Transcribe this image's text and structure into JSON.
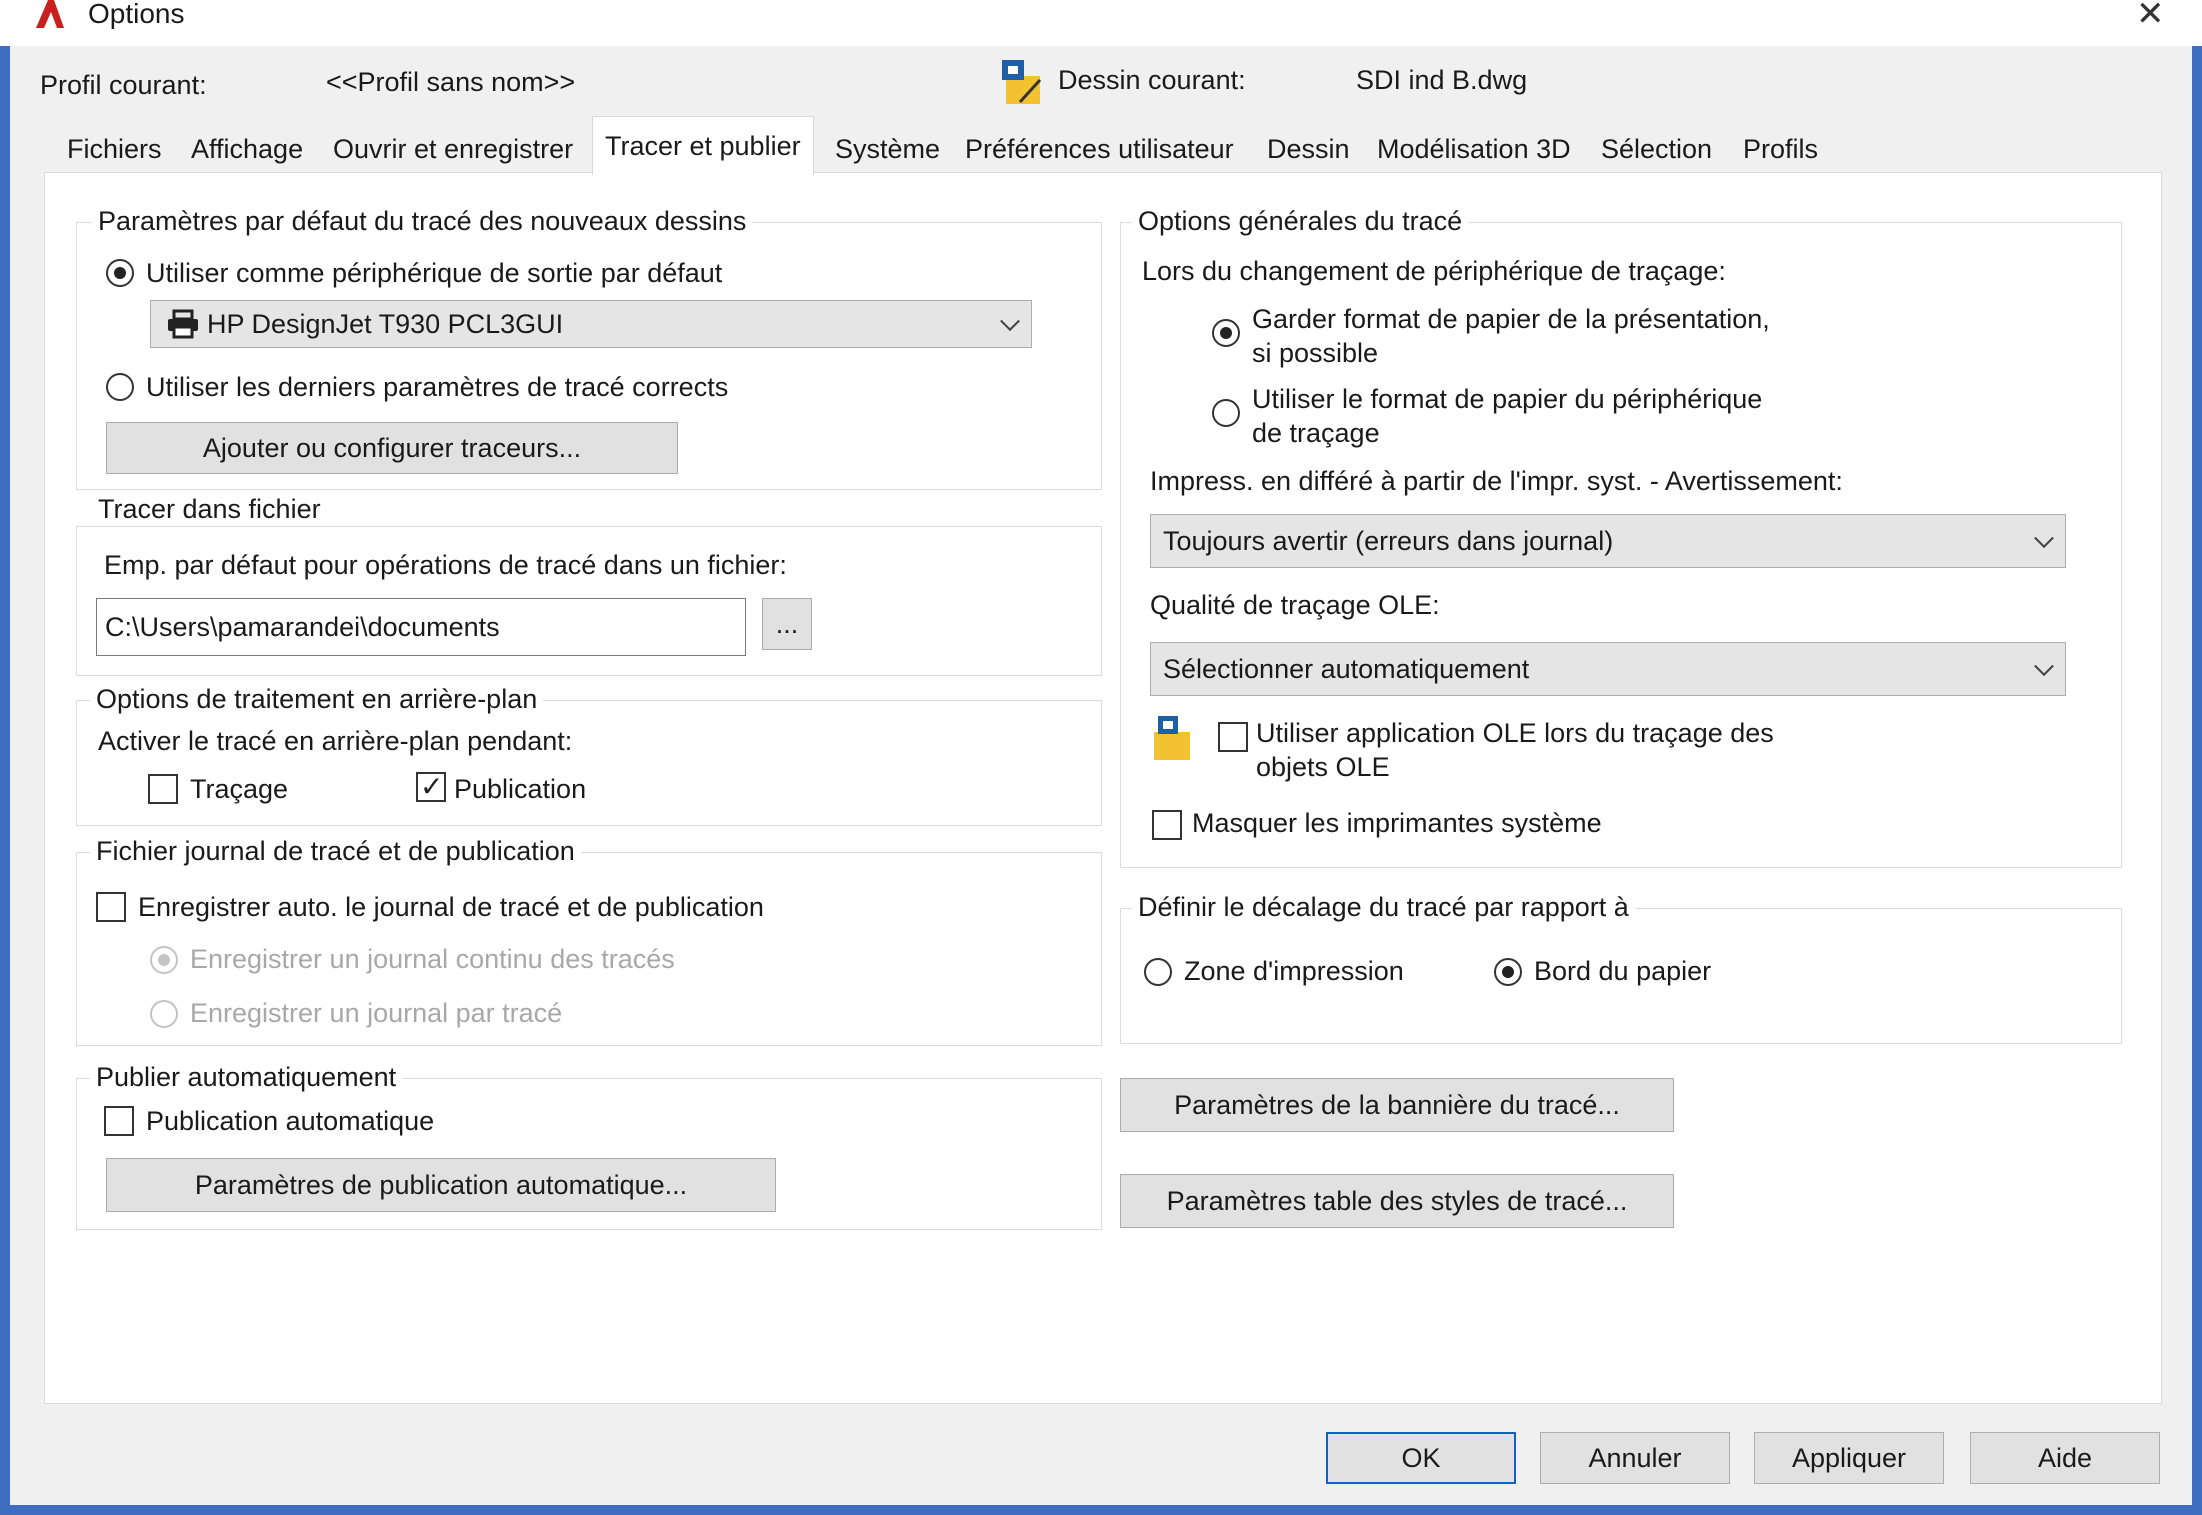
{
  "window": {
    "title": "Options",
    "close_glyph": "✕"
  },
  "header": {
    "profile_label": "Profil courant:",
    "profile_value": "<<Profil sans nom>>",
    "drawing_label": "Dessin courant:",
    "drawing_value": "SDI ind B.dwg"
  },
  "tabs": [
    {
      "label": "Fichiers",
      "active": false
    },
    {
      "label": "Affichage",
      "active": false
    },
    {
      "label": "Ouvrir et enregistrer",
      "active": false
    },
    {
      "label": "Tracer et publier",
      "active": true
    },
    {
      "label": "Système",
      "active": false
    },
    {
      "label": "Préférences utilisateur",
      "active": false
    },
    {
      "label": "Dessin",
      "active": false
    },
    {
      "label": "Modélisation 3D",
      "active": false
    },
    {
      "label": "Sélection",
      "active": false
    },
    {
      "label": "Profils",
      "active": false
    }
  ],
  "defaults": {
    "group_label": "Paramètres par défaut du tracé des nouveaux dessins",
    "radio_use_device": "Utiliser comme périphérique de sortie par défaut",
    "radio_use_device_checked": true,
    "device_value": "HP DesignJet T930 PCL3GUI",
    "radio_last_params": "Utiliser les derniers paramètres de tracé corrects",
    "radio_last_params_checked": false,
    "add_plotters_button": "Ajouter ou configurer traceurs..."
  },
  "plot_to_file": {
    "group_label": "Tracer dans fichier",
    "location_label": "Emp. par défaut pour opérations de tracé dans un fichier:",
    "path_value": "C:\\Users\\pamarandei\\documents",
    "browse_button": "..."
  },
  "background": {
    "group_label": "Options de traitement en arrière-plan",
    "enable_label": "Activer le tracé en arrière-plan pendant:",
    "plotting_label": "Traçage",
    "plotting_checked": false,
    "publishing_label": "Publication",
    "publishing_checked": true
  },
  "log": {
    "group_label": "Fichier journal de tracé et de publication",
    "auto_save_label": "Enregistrer auto. le journal de tracé et de publication",
    "auto_save_checked": false,
    "continuous_label": "Enregistrer un journal continu des tracés",
    "continuous_checked": true,
    "per_plot_label": "Enregistrer un journal par tracé",
    "per_plot_checked": false
  },
  "auto_publish": {
    "group_label": "Publier automatiquement",
    "checkbox_label": "Publication automatique",
    "checkbox_checked": false,
    "settings_button": "Paramètres de publication automatique..."
  },
  "general": {
    "group_label": "Options générales du tracé",
    "change_device_label": "Lors du changement de périphérique de traçage:",
    "keep_paper_line1": "Garder format de papier de la présentation,",
    "keep_paper_line2": "si possible",
    "keep_paper_checked": true,
    "use_device_paper_line1": "Utiliser le format de papier du périphérique",
    "use_device_paper_line2": "de traçage",
    "use_device_paper_checked": false,
    "spool_label": "Impress. en différé à partir de l'impr. syst. - Avertissement:",
    "spool_value": "Toujours avertir (erreurs dans journal)",
    "ole_quality_label": "Qualité de traçage OLE:",
    "ole_quality_value": "Sélectionner automatiquement",
    "ole_app_line1": "Utiliser application OLE lors du traçage des",
    "ole_app_line2": "objets OLE",
    "ole_app_checked": false,
    "hide_printers_label": "Masquer les imprimantes système",
    "hide_printers_checked": false
  },
  "offset": {
    "group_label": "Définir le décalage du tracé par rapport à",
    "printable_area_label": "Zone d'impression",
    "printable_area_checked": false,
    "paper_edge_label": "Bord du papier",
    "paper_edge_checked": true
  },
  "stamp_button": "Paramètres de la bannière du tracé...",
  "style_table_button": "Paramètres table des styles de tracé...",
  "footer": {
    "ok": "OK",
    "cancel": "Annuler",
    "apply": "Appliquer",
    "help": "Aide"
  },
  "colors": {
    "accent": "#0a64c8",
    "frame": "#3f6dbf",
    "app_icon": "#c8201e"
  },
  "icons": [
    "autocad-app-icon",
    "close-icon",
    "drawing-icon",
    "printer-icon",
    "chevron-down-icon",
    "ole-icon"
  ]
}
